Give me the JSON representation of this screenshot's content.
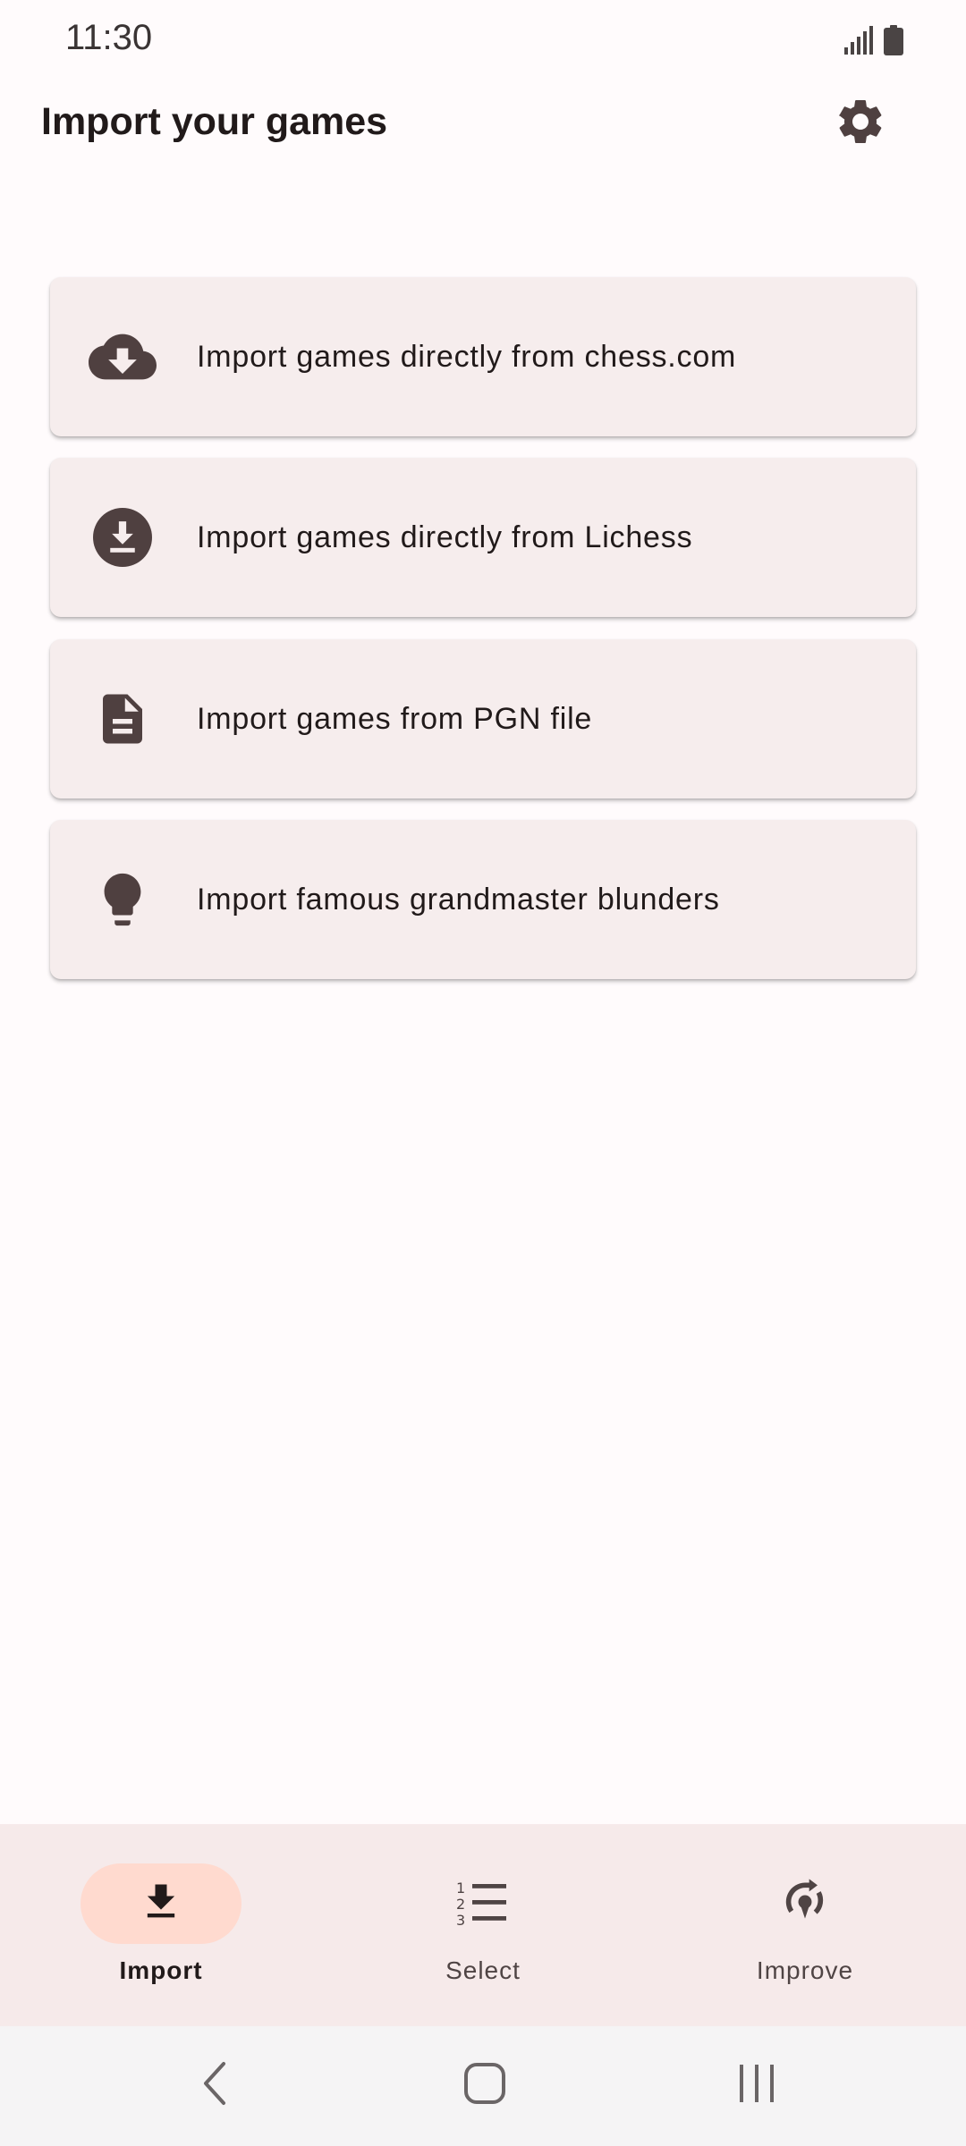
{
  "status_bar": {
    "time": "11:30",
    "icons": [
      "signal-icon",
      "battery-icon"
    ]
  },
  "header": {
    "title": "Import your games",
    "settings_icon": "gear-icon"
  },
  "import_options": [
    {
      "label": "Import games directly from chess.com",
      "icon": "cloud-download-icon"
    },
    {
      "label": "Import games directly from Lichess",
      "icon": "download-circle-icon"
    },
    {
      "label": "Import games from PGN file",
      "icon": "document-icon"
    },
    {
      "label": "Import famous grandmaster blunders",
      "icon": "lightbulb-icon"
    }
  ],
  "bottom_nav": {
    "items": [
      {
        "label": "Import",
        "icon": "download-icon",
        "active": true
      },
      {
        "label": "Select",
        "icon": "numbered-list-icon",
        "active": false
      },
      {
        "label": "Improve",
        "icon": "rotate-target-icon",
        "active": false
      }
    ]
  },
  "system_nav": [
    "back-icon",
    "home-icon",
    "recents-icon"
  ],
  "colors": {
    "background": "#fffbfc",
    "card": "#f6eded",
    "icon": "#4f4040",
    "nav_background": "#f6eaea",
    "active_pill": "#ffdacf"
  }
}
